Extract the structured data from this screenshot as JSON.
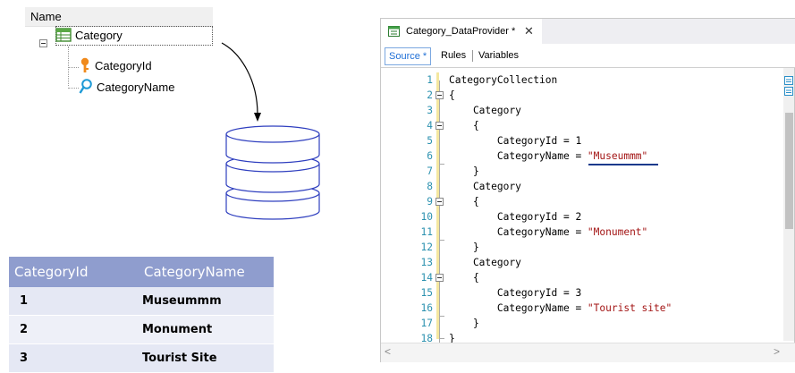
{
  "tree": {
    "header": "Name",
    "root_label": "Category",
    "children": [
      {
        "label": "CategoryId",
        "icon": "key-icon"
      },
      {
        "label": "CategoryName",
        "icon": "magnifier-icon"
      }
    ]
  },
  "result_table": {
    "headers": [
      "CategoryId",
      "CategoryName"
    ],
    "rows": [
      [
        "1",
        "Museummm"
      ],
      [
        "2",
        "Monument"
      ],
      [
        "3",
        "Tourist Site"
      ]
    ]
  },
  "editor": {
    "tab_title": "Category_DataProvider *",
    "close_glyph": "✕",
    "subtabs": [
      "Source *",
      "Rules",
      "Variables"
    ],
    "code_lines": [
      {
        "n": "1",
        "text": "CategoryCollection"
      },
      {
        "n": "2",
        "text": "{"
      },
      {
        "n": "3",
        "text": "    Category"
      },
      {
        "n": "4",
        "text": "    {"
      },
      {
        "n": "5",
        "text": "        CategoryId = 1"
      },
      {
        "n": "6",
        "text": "        CategoryName = ",
        "str": "\"Museummm\""
      },
      {
        "n": "7",
        "text": "    }"
      },
      {
        "n": "8",
        "text": "    Category"
      },
      {
        "n": "9",
        "text": "    {"
      },
      {
        "n": "10",
        "text": "        CategoryId = 2"
      },
      {
        "n": "11",
        "text": "        CategoryName = ",
        "str": "\"Monument\""
      },
      {
        "n": "12",
        "text": "    }"
      },
      {
        "n": "13",
        "text": "    Category"
      },
      {
        "n": "14",
        "text": "    {"
      },
      {
        "n": "15",
        "text": "        CategoryId = 3"
      },
      {
        "n": "16",
        "text": "        CategoryName = ",
        "str": "\"Tourist site\""
      },
      {
        "n": "17",
        "text": "    }"
      },
      {
        "n": "18",
        "text": "}"
      }
    ],
    "scroll_left": "<",
    "scroll_right": ">"
  },
  "colors": {
    "table_header": "#8f9dce",
    "line_numbers": "#2b91af",
    "string_literal": "#a31515",
    "active_subtab": "#1f6fd6",
    "database_stroke": "#2f3fbf"
  }
}
